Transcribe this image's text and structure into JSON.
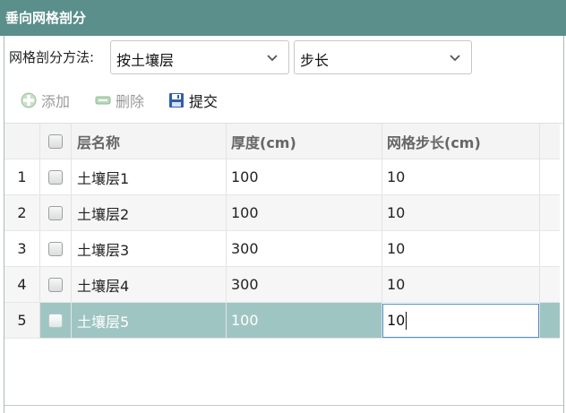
{
  "window": {
    "title": "垂向网格剖分"
  },
  "method": {
    "label": "网格剖分方法:",
    "select1_value": "按土壤层",
    "select2_value": "步长"
  },
  "toolbar": {
    "add_label": "添加",
    "delete_label": "删除",
    "submit_label": "提交"
  },
  "grid": {
    "headers": {
      "name": "层名称",
      "thickness": "厚度(cm)",
      "step": "网格步长(cm)"
    },
    "rows": [
      {
        "num": "1",
        "name": "土壤层1",
        "thickness": "100",
        "step": "10"
      },
      {
        "num": "2",
        "name": "土壤层2",
        "thickness": "100",
        "step": "10"
      },
      {
        "num": "3",
        "name": "土壤层3",
        "thickness": "300",
        "step": "10"
      },
      {
        "num": "4",
        "name": "土壤层4",
        "thickness": "300",
        "step": "10"
      },
      {
        "num": "5",
        "name": "土壤层5",
        "thickness": "100",
        "step": "10"
      }
    ]
  },
  "colors": {
    "titlebar": "#5b8f8c",
    "selected_row": "#9fc5c2",
    "edit_border": "#4d90c8"
  },
  "icons": {
    "add": "plus-circle-icon",
    "delete": "minus-bar-icon",
    "submit": "floppy-disk-icon",
    "dropdown": "chevron-down-icon"
  }
}
